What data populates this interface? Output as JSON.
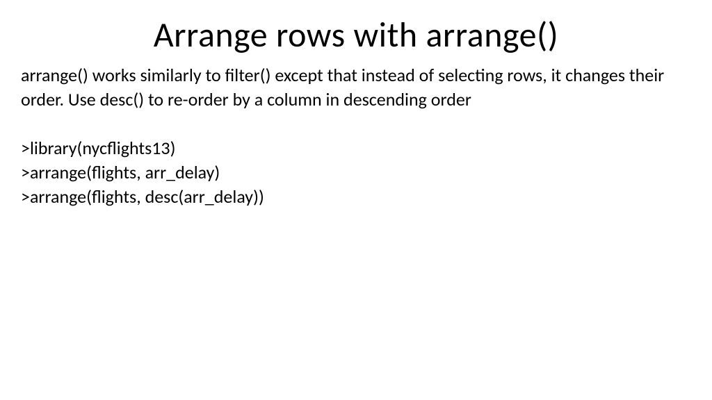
{
  "slide": {
    "title": "Arrange rows with arrange()",
    "description": "arrange() works similarly to filter() except that instead of selecting rows, it changes their order. Use desc() to re-order by a column in descending order",
    "code": {
      "line1": ">library(nycflights13)",
      "line2": ">arrange(flights, arr_delay)",
      "line3": ">arrange(flights, desc(arr_delay))"
    }
  }
}
